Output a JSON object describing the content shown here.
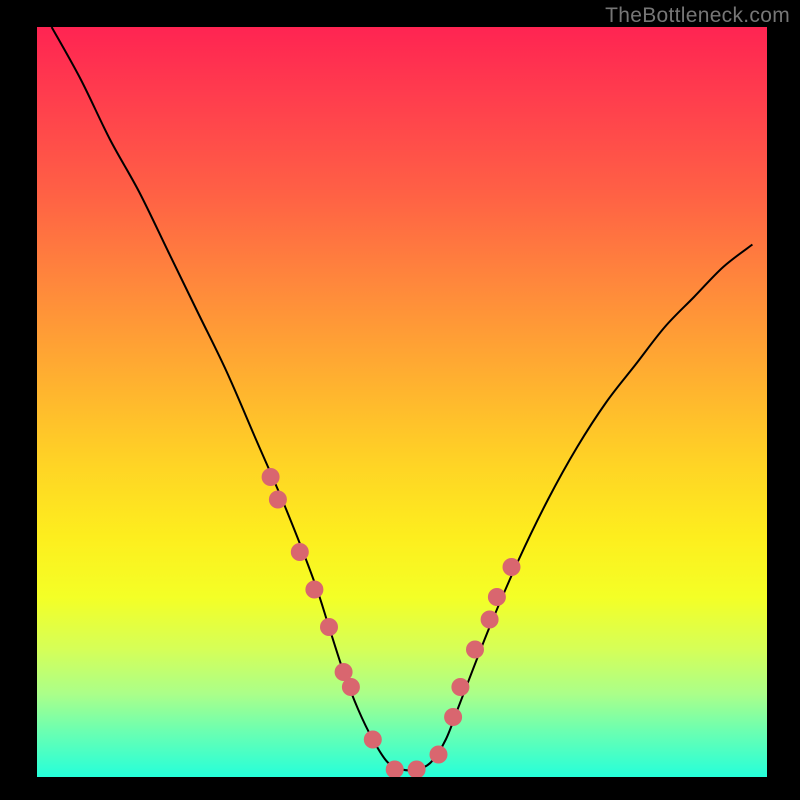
{
  "watermark": "TheBottleneck.com",
  "chart_data": {
    "type": "line",
    "title": "",
    "xlabel": "",
    "ylabel": "",
    "xlim": [
      0,
      100
    ],
    "ylim": [
      0,
      100
    ],
    "grid": false,
    "series": [
      {
        "name": "bottleneck-curve",
        "x": [
          2,
          6,
          10,
          14,
          18,
          22,
          26,
          30,
          34,
          38,
          40,
          42,
          44,
          46,
          48,
          50,
          52,
          54,
          56,
          58,
          62,
          66,
          70,
          74,
          78,
          82,
          86,
          90,
          94,
          98
        ],
        "y": [
          100,
          93,
          85,
          78,
          70,
          62,
          54,
          45,
          36,
          26,
          20,
          14,
          9,
          5,
          2,
          1,
          1,
          2,
          5,
          10,
          20,
          29,
          37,
          44,
          50,
          55,
          60,
          64,
          68,
          71
        ]
      }
    ],
    "markers": {
      "name": "highlight-dots",
      "x": [
        32,
        33,
        36,
        38,
        40,
        42,
        43,
        46,
        49,
        52,
        55,
        57,
        58,
        60,
        62,
        63,
        65
      ],
      "y": [
        40,
        37,
        30,
        25,
        20,
        14,
        12,
        5,
        1,
        1,
        3,
        8,
        12,
        17,
        21,
        24,
        28
      ]
    },
    "background_gradient": {
      "top": "#ff2452",
      "mid": "#fdee1e",
      "bottom": "#25ffda"
    }
  }
}
